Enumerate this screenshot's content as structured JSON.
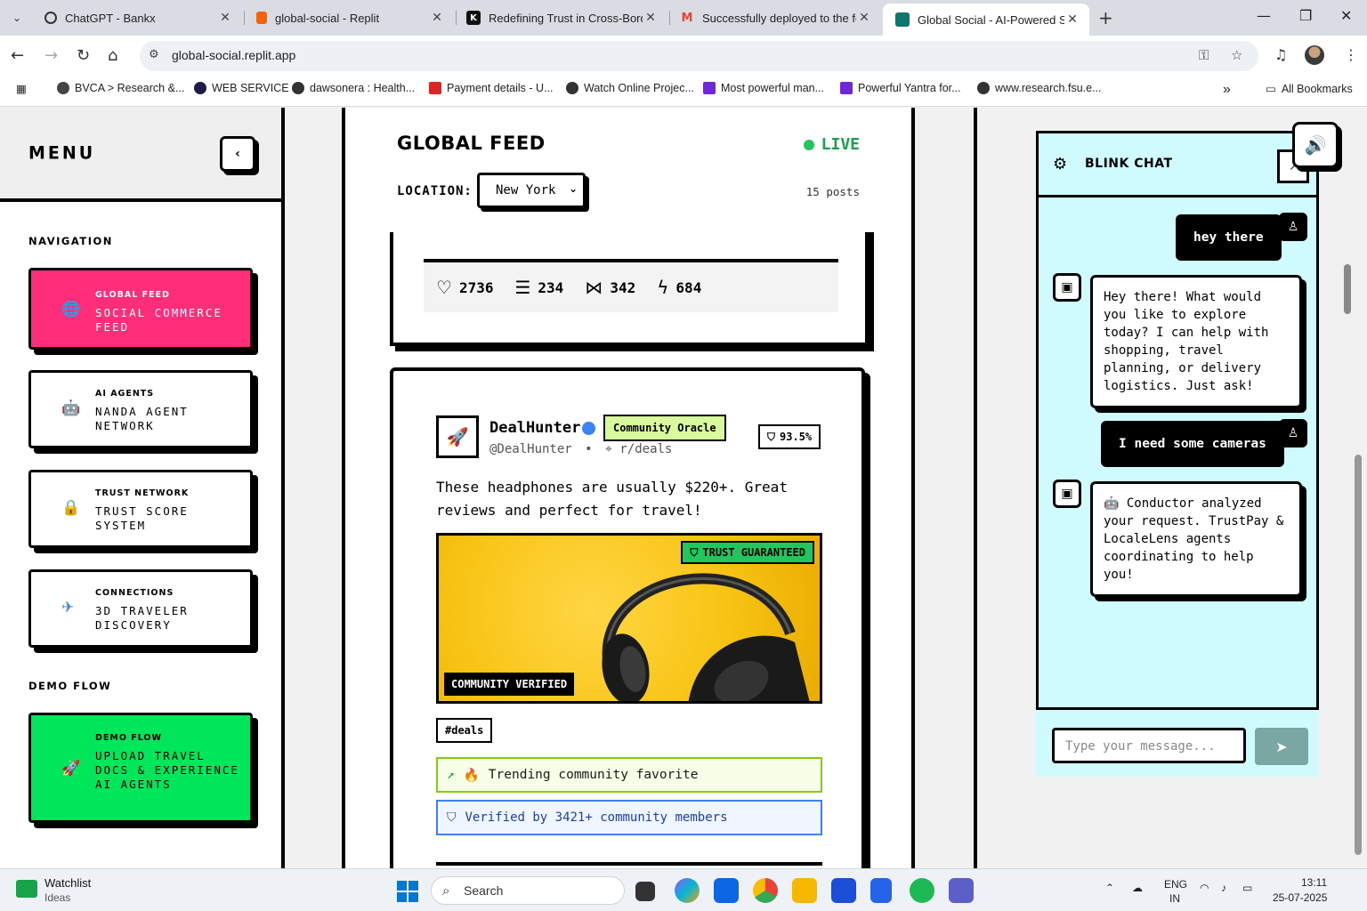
{
  "browser": {
    "tabs": [
      {
        "title": "ChatGPT - Bankx",
        "close": "✕"
      },
      {
        "title": "global-social - Replit",
        "close": "✕"
      },
      {
        "title": "Redefining Trust in Cross-Borde",
        "close": "✕"
      },
      {
        "title": "Successfully deployed to the fo",
        "close": "✕"
      },
      {
        "title": "Global Social - AI-Powered Soc",
        "close": "✕"
      }
    ],
    "url": "global-social.replit.app",
    "bookmarks": [
      "BVCA > Research &...",
      "WEB SERVICE",
      "dawsonera : Health...",
      "Payment details - U...",
      "Watch Online Projec...",
      "Most powerful man...",
      "Powerful Yantra for...",
      "www.research.fsu.e..."
    ],
    "all_bookmarks": "All Bookmarks"
  },
  "sidebar": {
    "title": "MENU",
    "navigation_label": "NAVIGATION",
    "items": [
      {
        "key": "GLOBAL FEED",
        "value": "SOCIAL COMMERCE FEED",
        "icon": "🌐",
        "color": "#ff2d7a"
      },
      {
        "key": "AI AGENTS",
        "value": "NANDA AGENT NETWORK",
        "icon": "🤖",
        "color": "#ffffff"
      },
      {
        "key": "TRUST NETWORK",
        "value": "TRUST SCORE SYSTEM",
        "icon": "🔒",
        "color": "#ffffff"
      },
      {
        "key": "CONNECTIONS",
        "value": "3D TRAVELER DISCOVERY",
        "icon": "✈",
        "color": "#ffffff"
      }
    ],
    "demo_label": "DEMO FLOW",
    "demo": {
      "key": "DEMO FLOW",
      "value": "UPLOAD TRAVEL DOCS & EXPERIENCE AI AGENTS",
      "icon": "🚀",
      "color": "#00e65a"
    }
  },
  "feed": {
    "title": "GLOBAL FEED",
    "live": "LIVE",
    "location_label": "LOCATION:",
    "location_value": "New York",
    "post_count": "15 posts",
    "prev_stats": {
      "likes": "2736",
      "comments": "234",
      "shares": "342",
      "boosts": "684"
    },
    "post": {
      "username": "DealHunter",
      "badge": "Community Oracle",
      "trust": "93.5%",
      "handle": "@DealHunter",
      "separator": "•",
      "community": "r/deals",
      "text": "These headphones are usually $220+. Great reviews and perfect for travel!",
      "image_tag": "TRUST GUARANTEED",
      "image_label": "COMMUNITY VERIFIED",
      "hashtag": "#deals",
      "trend": "Trending community favorite",
      "verified": "Verified by 3421+ community members"
    }
  },
  "chat": {
    "title": "BLINK CHAT",
    "messages": [
      {
        "from": "user",
        "text": "hey there"
      },
      {
        "from": "bot",
        "text": "Hey there! What would you like to explore today? I can help with shopping, travel planning, or delivery logistics. Just ask!"
      },
      {
        "from": "user",
        "text": "I need some cameras"
      },
      {
        "from": "bot",
        "text": "Conductor analyzed your request. TrustPay & LocaleLens agents coordinating to help you!"
      }
    ],
    "input_placeholder": "Type your message..."
  },
  "taskbar": {
    "widget_title": "Watchlist",
    "widget_sub": "Ideas",
    "search": "Search",
    "lang_top": "ENG",
    "lang_bottom": "IN",
    "time": "13:11",
    "date": "25-07-2025"
  }
}
